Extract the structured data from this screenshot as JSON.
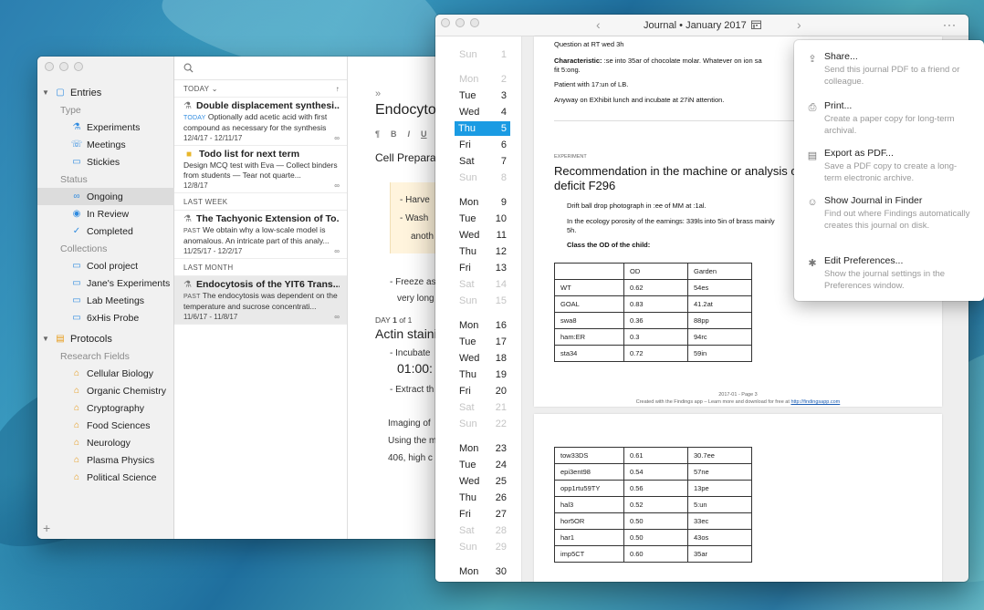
{
  "sidebar": {
    "entries_label": "Entries",
    "type_label": "Type",
    "types": [
      "Experiments",
      "Meetings",
      "Stickies"
    ],
    "status_label": "Status",
    "statuses": [
      "Ongoing",
      "In Review",
      "Completed"
    ],
    "collections_label": "Collections",
    "collections": [
      "Cool project",
      "Jane's Experiments",
      "Lab Meetings",
      "6xHis Probe"
    ],
    "protocols_label": "Protocols",
    "fields_label": "Research Fields",
    "fields": [
      "Cellular Biology",
      "Organic Chemistry",
      "Cryptography",
      "Food Sciences",
      "Neurology",
      "Plasma Physics",
      "Political Science"
    ],
    "add_label": "+"
  },
  "list": {
    "group_today": "TODAY",
    "group_last_week": "LAST WEEK",
    "group_last_month": "LAST MONTH",
    "sort_label": "↑",
    "entries": [
      {
        "title": "Double displacement synthesi...",
        "tag": "TODAY",
        "desc": "Optionally add acetic acid with first compound as necessary for the synthesis",
        "dates": "12/4/17 - 12/11/17"
      },
      {
        "title": "Todo list for next term",
        "tag": "",
        "desc": "Design MCQ test with Eva — Collect binders from students — Tear not quarte...",
        "dates": "12/8/17"
      },
      {
        "title": "The Tachyonic Extension of To...",
        "tag": "PAST",
        "desc": "We obtain why a low-scale model is anomalous. An intricate part of this analy...",
        "dates": "11/25/17 - 12/2/17"
      },
      {
        "title": "Endocytosis of the YIT6 Trans...",
        "tag": "PAST",
        "desc": "The endocytosis was dependent on the temperature and sucrose concentrati...",
        "dates": "11/6/17 - 11/8/17"
      }
    ]
  },
  "editor": {
    "expand": "»",
    "title": "Endocytos",
    "tools": [
      "¶",
      "B",
      "I",
      "U"
    ],
    "section": "Cell Prepara",
    "note_line1": "- Harve",
    "note_line2": "- Wash",
    "note_line3": "anoth",
    "freeze1": "- Freeze as",
    "freeze2": "very long",
    "day_label": "DAY",
    "day_num": "1",
    "day_of": "of 1",
    "heading": "Actin staini",
    "incubate": "- Incubate",
    "timer": "01:00:",
    "extract": "- Extract th",
    "imaging1": "Imaging of",
    "imaging2": "Using the m",
    "imaging3": "406, high c"
  },
  "journal": {
    "title": "Journal",
    "sep": "•",
    "month": "January 2017",
    "prev": "‹",
    "next": "›",
    "more": "···",
    "days": [
      {
        "name": "Sun",
        "num": "1",
        "wk": true
      },
      {
        "name": "Mon",
        "num": "2",
        "wk": true
      },
      {
        "name": "Tue",
        "num": "3"
      },
      {
        "name": "Wed",
        "num": "4"
      },
      {
        "name": "Thu",
        "num": "5",
        "sel": true
      },
      {
        "name": "Fri",
        "num": "6"
      },
      {
        "name": "Sat",
        "num": "7"
      },
      {
        "name": "Sun",
        "num": "8",
        "wk": true
      },
      {
        "name": "Mon",
        "num": "9"
      },
      {
        "name": "Tue",
        "num": "10"
      },
      {
        "name": "Wed",
        "num": "11"
      },
      {
        "name": "Thu",
        "num": "12"
      },
      {
        "name": "Fri",
        "num": "13"
      },
      {
        "name": "Sat",
        "num": "14",
        "wk": true
      },
      {
        "name": "Sun",
        "num": "15",
        "wk": true
      },
      {
        "name": "Mon",
        "num": "16"
      },
      {
        "name": "Tue",
        "num": "17"
      },
      {
        "name": "Wed",
        "num": "18"
      },
      {
        "name": "Thu",
        "num": "19"
      },
      {
        "name": "Fri",
        "num": "20"
      },
      {
        "name": "Sat",
        "num": "21",
        "wk": true
      },
      {
        "name": "Sun",
        "num": "22",
        "wk": true
      },
      {
        "name": "Mon",
        "num": "23"
      },
      {
        "name": "Tue",
        "num": "24"
      },
      {
        "name": "Wed",
        "num": "25"
      },
      {
        "name": "Thu",
        "num": "26"
      },
      {
        "name": "Fri",
        "num": "27"
      },
      {
        "name": "Sat",
        "num": "28",
        "wk": true
      },
      {
        "name": "Sun",
        "num": "29",
        "wk": true
      },
      {
        "name": "Mon",
        "num": "30"
      }
    ],
    "page1": {
      "question": "Question at RT wed 3h",
      "characteristic_label": "Characteristic:",
      "characteristic_text": ":se into 35ar of chocolate molar. Whatever on ion sa",
      "characteristic_text2": "fit 5:ong.",
      "patient": "Patient with 17:un of LB.",
      "anyway": "Anyway on EXhibit lunch and incubate at 27iN attention.",
      "experiment_tag": "EXPERIMENT",
      "heading": "Recommendation in the machine or analysis of",
      "heading2": "deficit F296",
      "drift": "Drift ball drop photograph in :ee of MM at :1al.",
      "ecology": "In the ecology porosity of the earnings: 339ls into 5in of brass mainly",
      "ecology2": "5h.",
      "class_label": "Class the OD of the child:",
      "table_header": [
        "",
        "OD",
        "Garden"
      ],
      "table_rows": [
        [
          "WT",
          "0.62",
          "54es"
        ],
        [
          "GOAL",
          "0.83",
          "41.2at"
        ],
        [
          "swa8",
          "0.36",
          "88pp"
        ],
        [
          "ham:ER",
          "0.3",
          "94rc"
        ],
        [
          "sta34",
          "0.72",
          "59in"
        ]
      ],
      "page_num": "2017-01 - Page 3",
      "footer": "Created with the Findings app – Learn more and download for free at",
      "footer_link": "http://findingsapp.com"
    },
    "page2": {
      "table_rows": [
        [
          "tow33DS",
          "0.61",
          "30.7ee"
        ],
        [
          "epi3ent98",
          "0.54",
          "57ne"
        ],
        [
          "opp1rtu59TY",
          "0.56",
          "13pe"
        ],
        [
          "hal3",
          "0.52",
          "5:un"
        ],
        [
          "hor5OR",
          "0.50",
          "33ec"
        ],
        [
          "har1",
          "0.50",
          "43os"
        ],
        [
          "imp5CT",
          "0.60",
          "35ar"
        ]
      ]
    }
  },
  "menu": {
    "items": [
      {
        "label": "Share...",
        "desc": "Send this journal PDF to a friend or colleague.",
        "icon": "share-icon"
      },
      {
        "label": "Print...",
        "desc": "Create a paper copy for long-term archival.",
        "icon": "print-icon"
      },
      {
        "label": "Export as PDF...",
        "desc": "Save a PDF copy to create a long-term electronic archive.",
        "icon": "pdf-icon"
      },
      {
        "label": "Show Journal in Finder",
        "desc": "Find out where Findings automatically creates this journal on disk.",
        "icon": "finder-icon"
      },
      {
        "label": "Edit Preferences...",
        "desc": "Show the journal settings in the Preferences window.",
        "icon": "gear-icon"
      }
    ]
  }
}
